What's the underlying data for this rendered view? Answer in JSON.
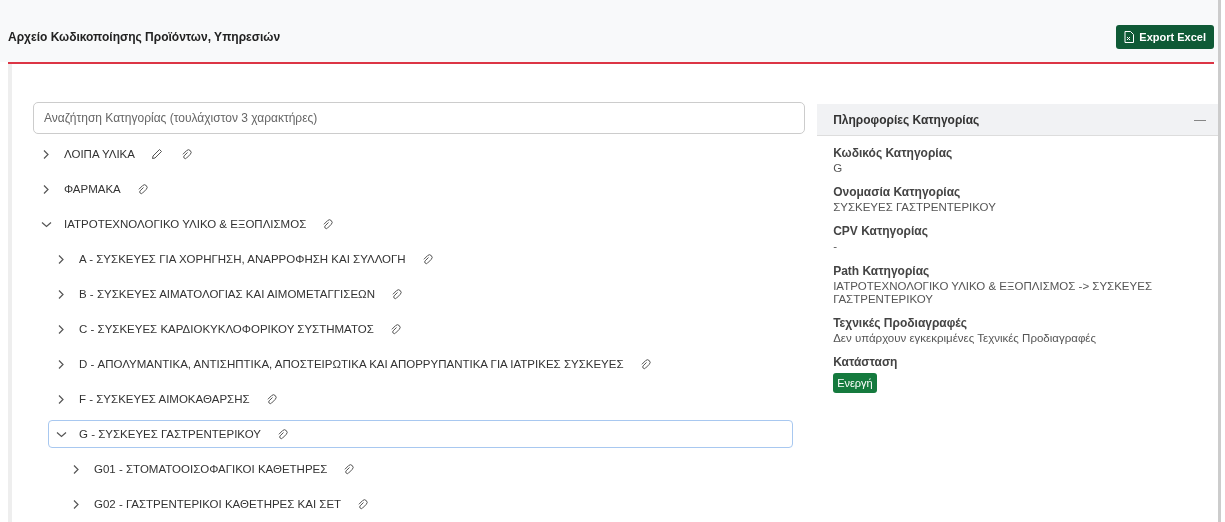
{
  "header": {
    "title": "Αρχείο Κωδικοποίησης Προϊόντων, Υπηρεσιών",
    "export_button": "Export Excel"
  },
  "search": {
    "placeholder": "Αναζήτηση Κατηγορίας (τουλάχιστον 3 χαρακτήρες)"
  },
  "tree": [
    {
      "label": "ΛΟΙΠΑ ΥΛΙΚΑ",
      "expanded": false,
      "selected": false,
      "editable": true
    },
    {
      "label": "ΦΑΡΜΑΚΑ",
      "expanded": false,
      "selected": false,
      "editable": false
    },
    {
      "label": "ΙΑΤΡΟΤΕΧΝΟΛΟΓΙΚΟ ΥΛΙΚΟ & ΕΞΟΠΛΙΣΜΟΣ",
      "expanded": true,
      "selected": false,
      "editable": false,
      "children": [
        {
          "label": "A - ΣΥΣΚΕΥΕΣ ΓΙΑ ΧΟΡΗΓΗΣΗ, ΑΝΑΡΡΟΦΗΣΗ ΚΑΙ ΣΥΛΛΟΓΗ",
          "expanded": false,
          "selected": false,
          "editable": false
        },
        {
          "label": "B - ΣΥΣΚΕΥΕΣ ΑΙΜΑΤΟΛΟΓΙΑΣ ΚΑΙ ΑΙΜΟΜΕΤΑΓΓΙΣΕΩΝ",
          "expanded": false,
          "selected": false,
          "editable": false
        },
        {
          "label": "C - ΣΥΣΚΕΥΕΣ ΚΑΡΔΙΟΚΥΚΛΟΦΟΡΙΚΟΥ ΣΥΣΤΗΜΑΤΟΣ",
          "expanded": false,
          "selected": false,
          "editable": false
        },
        {
          "label": "D - ΑΠΟΛΥΜΑΝΤΙΚΑ, ΑΝΤΙΣΗΠΤΙΚΑ, ΑΠΟΣΤΕΙΡΩΤΙΚΑ ΚΑΙ ΑΠΟΡΡΥΠΑΝΤΙΚΑ ΓΙΑ ΙΑΤΡΙΚΕΣ ΣΥΣΚΕΥΕΣ",
          "expanded": false,
          "selected": false,
          "editable": false
        },
        {
          "label": "F - ΣΥΣΚΕΥΕΣ ΑΙΜΟΚΑΘΑΡΣΗΣ",
          "expanded": false,
          "selected": false,
          "editable": false
        },
        {
          "label": "G - ΣΥΣΚΕΥΕΣ ΓΑΣΤΡΕΝΤΕΡΙΚΟΥ",
          "expanded": true,
          "selected": true,
          "editable": false,
          "children": [
            {
              "label": "G01 - ΣΤΟΜΑΤΟΟΙΣΟΦΑΓΙΚΟΙ ΚΑΘΕΤΗΡΕΣ",
              "expanded": false,
              "selected": false,
              "editable": false
            },
            {
              "label": "G02 - ΓΑΣΤΡΕΝΤΕΡΙΚΟΙ ΚΑΘΕΤΗΡΕΣ ΚΑΙ ΣΕΤ",
              "expanded": false,
              "selected": false,
              "editable": false
            }
          ]
        }
      ]
    }
  ],
  "info_panel": {
    "title": "Πληροφορίες Κατηγορίας",
    "collapse_button": "—",
    "fields": [
      {
        "label": "Κωδικός Κατηγορίας",
        "value": "G"
      },
      {
        "label": "Ονομασία Κατηγορίας",
        "value": "ΣΥΣΚΕΥΕΣ ΓΑΣΤΡΕΝΤΕΡΙΚΟΥ"
      },
      {
        "label": "CPV Κατηγορίας",
        "value": "-"
      },
      {
        "label": "Path Κατηγορίας",
        "value": "ΙΑΤΡΟΤΕΧΝΟΛΟΓΙΚΟ ΥΛΙΚΟ & ΕΞΟΠΛΙΣΜΟΣ -> ΣΥΣΚΕΥΕΣ ΓΑΣΤΡΕΝΤΕΡΙΚΟΥ"
      },
      {
        "label": "Τεχνικές Προδιαγραφές",
        "value": "Δεν υπάρχουν εγκεκριμένες Τεχνικές Προδιαγραφές"
      }
    ],
    "status": {
      "label": "Κατάσταση",
      "badge": "Ενεργή"
    }
  }
}
